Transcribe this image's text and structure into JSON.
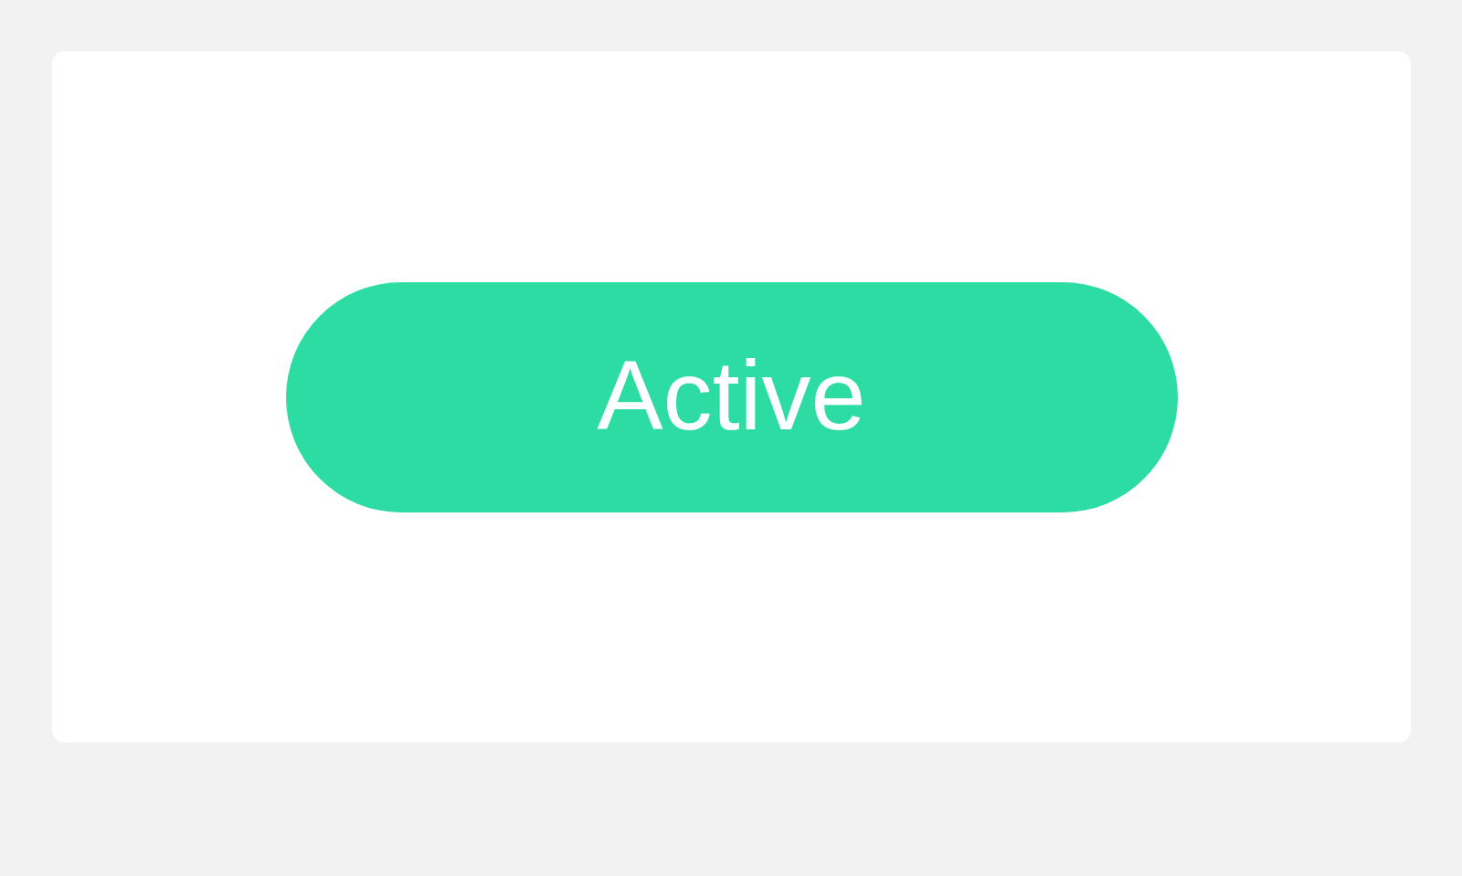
{
  "card": {
    "button": {
      "label": "Active"
    }
  }
}
